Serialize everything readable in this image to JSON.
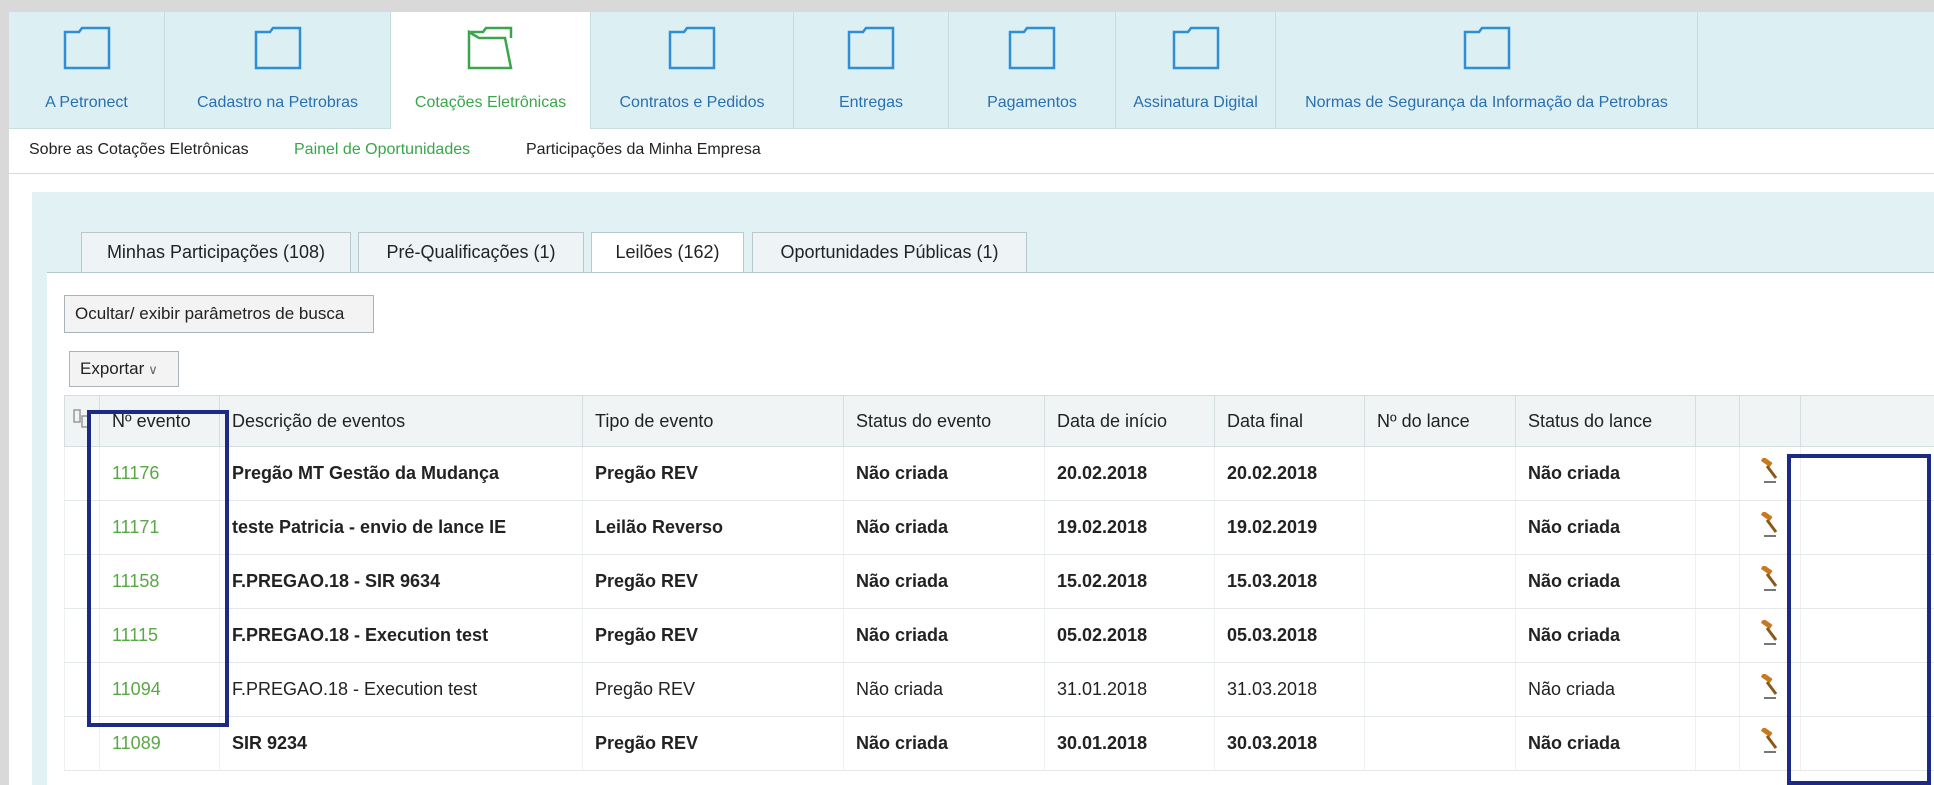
{
  "nav": {
    "items": [
      {
        "label": "A Petronect",
        "active": false
      },
      {
        "label": "Cadastro na Petrobras",
        "active": false
      },
      {
        "label": "Cotações Eletrônicas",
        "active": true
      },
      {
        "label": "Contratos e Pedidos",
        "active": false
      },
      {
        "label": "Entregas",
        "active": false
      },
      {
        "label": "Pagamentos",
        "active": false
      },
      {
        "label": "Assinatura Digital",
        "active": false
      },
      {
        "label": "Normas de Segurança da Informação da Petrobras",
        "active": false
      }
    ]
  },
  "subnav": {
    "items": [
      {
        "label": "Sobre as Cotações Eletrônicas",
        "active": false
      },
      {
        "label": "Painel de Oportunidades",
        "active": true
      },
      {
        "label": "Participações da Minha Empresa",
        "active": false
      }
    ]
  },
  "tabs": [
    {
      "label": "Minhas Participações (108)",
      "active": false
    },
    {
      "label": "Pré-Qualificações (1)",
      "active": false
    },
    {
      "label": "Leilões (162)",
      "active": true
    },
    {
      "label": "Oportunidades Públicas (1)",
      "active": false
    }
  ],
  "toolbar": {
    "toggle_label": "Ocultar/ exibir parâmetros de busca",
    "export_label": "Exportar",
    "export_chevron": "∨"
  },
  "table": {
    "columns": [
      "Nº evento",
      "Descrição de eventos",
      "Tipo de evento",
      "Status do evento",
      "Data de início",
      "Data final",
      "Nº do lance",
      "Status do lance"
    ],
    "rows": [
      {
        "num": "11176",
        "desc": "Pregão MT Gestão da Mudança",
        "tipo": "Pregão REV",
        "status": "Não criada",
        "inicio": "20.02.2018",
        "final": "20.02.2018",
        "lance": "",
        "status_lance": "Não criada",
        "bold": true
      },
      {
        "num": "11171",
        "desc": "teste Patricia - envio de lance IE",
        "tipo": "Leilão Reverso",
        "status": "Não criada",
        "inicio": "19.02.2018",
        "final": "19.02.2019",
        "lance": "",
        "status_lance": "Não criada",
        "bold": true
      },
      {
        "num": "11158",
        "desc": "F.PREGAO.18 - SIR 9634",
        "tipo": "Pregão REV",
        "status": "Não criada",
        "inicio": "15.02.2018",
        "final": "15.03.2018",
        "lance": "",
        "status_lance": "Não criada",
        "bold": true
      },
      {
        "num": "11115",
        "desc": "F.PREGAO.18 - Execution test",
        "tipo": "Pregão REV",
        "status": "Não criada",
        "inicio": "05.02.2018",
        "final": "05.03.2018",
        "lance": "",
        "status_lance": "Não criada",
        "bold": true
      },
      {
        "num": "11094",
        "desc": "F.PREGAO.18 - Execution test",
        "tipo": "Pregão REV",
        "status": "Não criada",
        "inicio": "31.01.2018",
        "final": "31.03.2018",
        "lance": "",
        "status_lance": "Não criada",
        "bold": false
      },
      {
        "num": "11089",
        "desc": "SIR 9234",
        "tipo": "Pregão REV",
        "status": "Não criada",
        "inicio": "30.01.2018",
        "final": "30.03.2018",
        "lance": "",
        "status_lance": "Não criada",
        "bold": true
      }
    ]
  },
  "icons": {
    "folder": "folder-icon",
    "folder_open": "folder-open-icon",
    "bid": "auction-hammer-icon",
    "settings": "table-settings-icon"
  },
  "colors": {
    "nav_bg": "#dceff3",
    "link_blue": "#2a6fb0",
    "active_green": "#3aa64a",
    "event_number_green": "#58a844",
    "highlight_border": "#1c2a86"
  }
}
